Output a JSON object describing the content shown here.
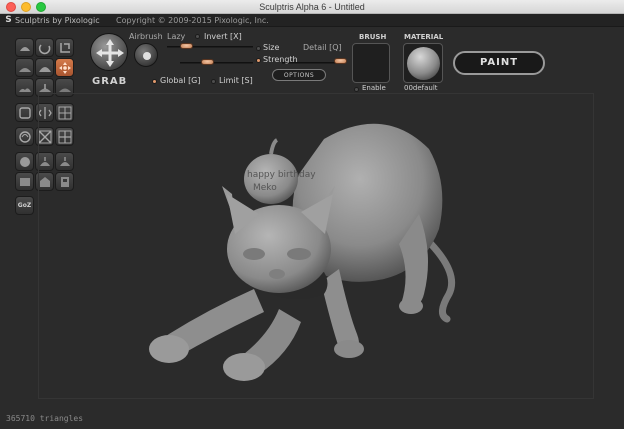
{
  "window": {
    "title": "Sculptris Alpha 6 - Untitled",
    "traffic_light_colors": [
      "#fc5f57",
      "#fdbc2e",
      "#28c840"
    ]
  },
  "app_header": {
    "logo_icon": "sculptris-s-icon",
    "app_name": "Sculptris by Pixologic",
    "copyright": "Copyright © 2009-2015 Pixologic, Inc."
  },
  "tool_palette": {
    "icons": [
      "draw-icon",
      "crease-icon",
      "rotate-icon",
      "flatten-icon",
      "inflate-icon",
      "grab-icon",
      "smooth-icon",
      "pinch-icon",
      "reduce-brush-icon",
      "mask-icon",
      "symmetry-icon",
      "wireframe-icon",
      "subdivide-icon",
      "reduce-selected-icon",
      "grid-icon",
      "new-sphere-icon",
      "open-icon",
      "save-icon",
      "import-icon",
      "export-icon",
      "settings-icon"
    ],
    "active_tool": "grab-icon",
    "goz_label": "GoZ",
    "accent_color": "#d47a4a"
  },
  "tool_options": {
    "tool_name": "GRAB",
    "airbrush_label": "Airbrush",
    "lazy_label": "Lazy",
    "invert_label": "Invert [X]",
    "size_label": "Size",
    "detail_label": "Detail [Q]",
    "strength_label": "Strength",
    "global_label": "Global [G]",
    "limit_label": "Limit [S]",
    "options_button": "OPTIONS",
    "global_on": true,
    "strength_on": true
  },
  "brush": {
    "label": "BRUSH",
    "enable_label": "Enable"
  },
  "material": {
    "label": "MATERIAL",
    "name": "00default"
  },
  "paint_button": "PAINT",
  "model_text": {
    "line1": "happy birthday",
    "line2": "Meko"
  },
  "status_bar": {
    "triangles": "365710 triangles"
  }
}
